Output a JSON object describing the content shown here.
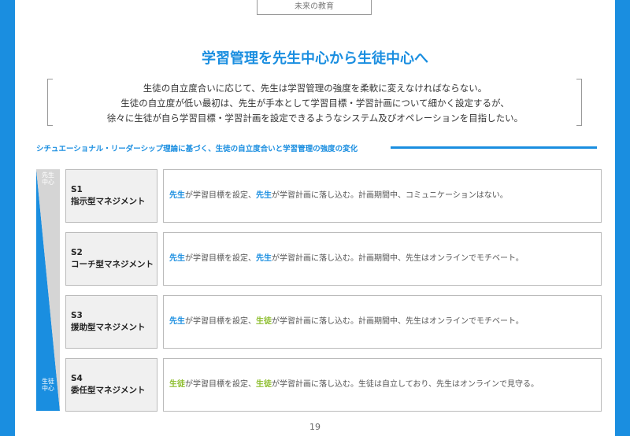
{
  "header": {
    "tab_label": "未来の教育",
    "page_title": "学習管理を先生中心から生徒中心へ"
  },
  "lead": [
    "生徒の自立度合いに応じて、先生は学習管理の強度を柔軟に変えなければならない。",
    "生徒の自立度が低い最初は、先生が手本として学習目標・学習計画について細かく設定するが、",
    "徐々に生徒が自ら学習目標・学習計画を設定できるようなシステム及びオペレーションを目指したい。"
  ],
  "section": {
    "heading": "シチュエーショナル・リーダーシップ理論に基づく、生徒の自立度合いと学習管理の強度の変化"
  },
  "axis": {
    "top_label": "先生中心",
    "bottom_label": "生徒中心"
  },
  "colors": {
    "accent": "#1a8ee0",
    "student": "#8cbd2c"
  },
  "rows": [
    {
      "code": "S1",
      "name": "指示型マネジメント",
      "who_goal": "先生",
      "goal_text": "が学習目標を設定、",
      "who_plan": "先生",
      "rest": "が学習計画に落し込む。計画期間中、コミュニケーションはない。"
    },
    {
      "code": "S2",
      "name": "コーチ型マネジメント",
      "who_goal": "先生",
      "goal_text": "が学習目標を設定、",
      "who_plan": "先生",
      "rest": "が学習計画に落し込む。計画期間中、先生はオンラインでモチベート。"
    },
    {
      "code": "S3",
      "name": "援助型マネジメント",
      "who_goal": "先生",
      "goal_text": "が学習目標を設定、",
      "who_plan": "生徒",
      "rest": "が学習計画に落し込む。計画期間中、先生はオンラインでモチベート。"
    },
    {
      "code": "S4",
      "name": "委任型マネジメント",
      "who_goal": "生徒",
      "goal_text": "が学習目標を設定、",
      "who_plan": "生徒",
      "rest": "が学習計画に落し込む。生徒は自立しており、先生はオンラインで見守る。"
    }
  ],
  "footer": {
    "page_number": "19"
  }
}
